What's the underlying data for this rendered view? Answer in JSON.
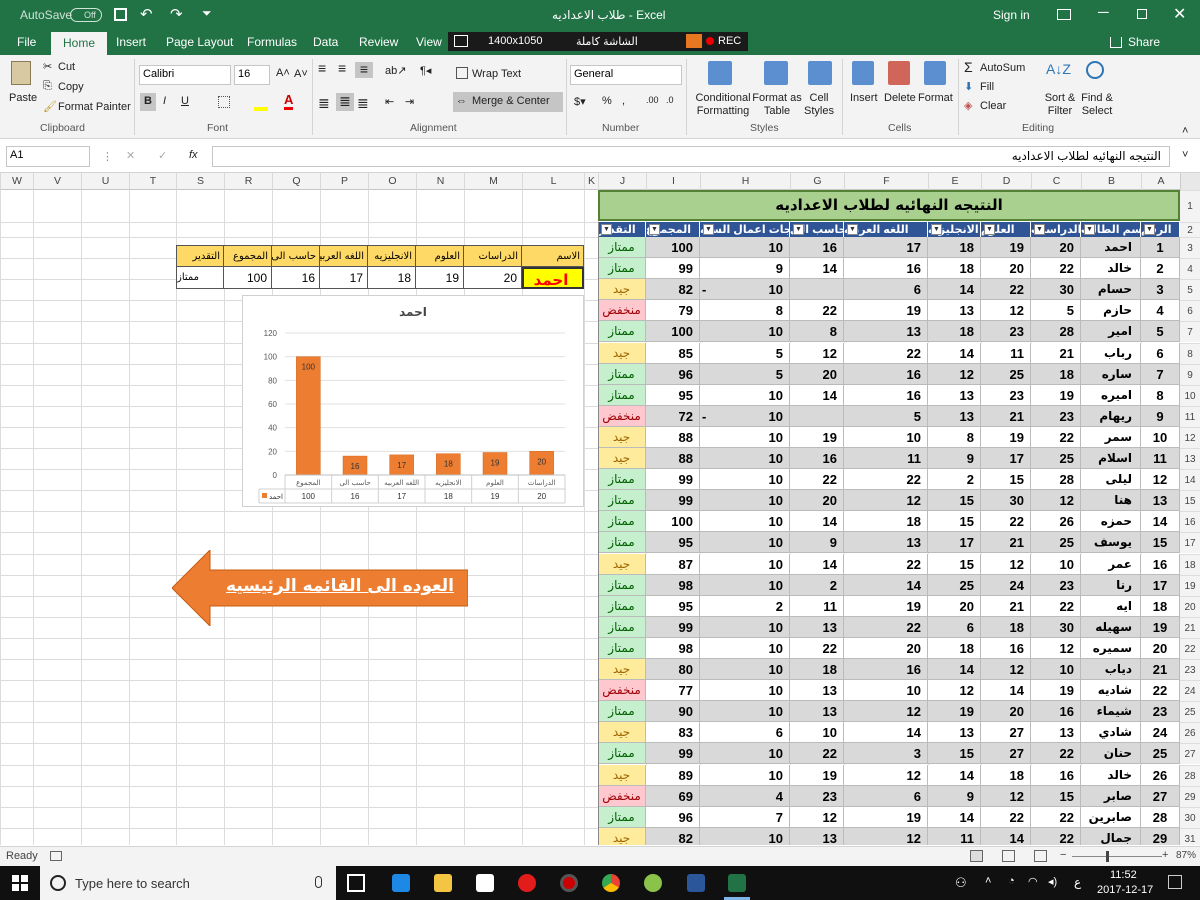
{
  "titlebar": {
    "autosave": "AutoSave",
    "autosave_state": "Off",
    "title": "طلاب الاعداديه  -  Excel",
    "signin": "Sign in"
  },
  "tabs": [
    "File",
    "Home",
    "Insert",
    "Page Layout",
    "Formulas",
    "Data",
    "Review",
    "View"
  ],
  "recorder": {
    "resolution": "1400x1050",
    "mode": "الشاشة كاملة",
    "rec": "REC"
  },
  "share": "Share",
  "ribbon": {
    "clipboard": {
      "paste": "Paste",
      "cut": "Cut",
      "copy": "Copy",
      "format_painter": "Format Painter",
      "group": "Clipboard"
    },
    "font": {
      "name": "Calibri",
      "size": "16",
      "bold": "B",
      "italic": "I",
      "underline": "U",
      "group": "Font"
    },
    "alignment": {
      "wrap": "Wrap Text",
      "merge": "Merge & Center",
      "group": "Alignment"
    },
    "number": {
      "format": "General",
      "group": "Number"
    },
    "styles": {
      "conditional": "Conditional Formatting",
      "format_table": "Format as Table",
      "cell_styles": "Cell Styles",
      "group": "Styles"
    },
    "cells": {
      "insert": "Insert",
      "delete": "Delete",
      "format": "Format",
      "group": "Cells"
    },
    "editing": {
      "autosum": "AutoSum",
      "fill": "Fill",
      "clear": "Clear",
      "sort": "Sort & Filter",
      "find": "Find & Select",
      "group": "Editing"
    }
  },
  "formula_bar": {
    "name_box": "A1",
    "fx": "fx",
    "content": "النتيجه النهائيه لطلاب الاعداديه"
  },
  "columns": [
    "W",
    "V",
    "U",
    "T",
    "S",
    "R",
    "Q",
    "P",
    "O",
    "N",
    "M",
    "L",
    "K",
    "J",
    "I",
    "H",
    "G",
    "F",
    "E",
    "D",
    "C",
    "B",
    "A"
  ],
  "row_numbers": [
    1,
    2,
    3,
    4,
    5,
    6,
    7,
    8,
    9,
    10,
    11,
    12,
    13,
    14,
    15,
    16,
    17,
    18,
    19,
    20,
    21,
    22,
    23,
    24,
    25,
    26,
    27,
    28,
    29,
    30,
    31
  ],
  "sheet_title": "النتيجه النهائيه لطلاب الاعداديه",
  "table_headers": [
    "الرقم",
    "اسم الطالب",
    "الدراسات",
    "العلوم",
    "الانجليزيه",
    "اللغه العربيه",
    "حاسب الى",
    "درجات اعمال السنه",
    "المجموع",
    "التقدير"
  ],
  "students": [
    [
      "1",
      "احمد",
      "20",
      "19",
      "18",
      "17",
      "16",
      "10",
      "100",
      "ممتاز"
    ],
    [
      "2",
      "خالد",
      "22",
      "20",
      "18",
      "16",
      "14",
      "9",
      "99",
      "ممتاز"
    ],
    [
      "3",
      "حسام",
      "30",
      "22",
      "14",
      "6",
      "",
      "10",
      "82",
      "جيد"
    ],
    [
      "4",
      "حازم",
      "5",
      "12",
      "13",
      "19",
      "22",
      "8",
      "79",
      "منخفض"
    ],
    [
      "5",
      "امير",
      "28",
      "23",
      "18",
      "13",
      "8",
      "10",
      "100",
      "ممتاز"
    ],
    [
      "6",
      "رباب",
      "21",
      "11",
      "14",
      "22",
      "12",
      "5",
      "85",
      "جيد"
    ],
    [
      "7",
      "ساره",
      "18",
      "25",
      "12",
      "16",
      "20",
      "5",
      "96",
      "ممتاز"
    ],
    [
      "8",
      "اميره",
      "19",
      "23",
      "13",
      "16",
      "14",
      "10",
      "95",
      "ممتاز"
    ],
    [
      "9",
      "ريهام",
      "23",
      "21",
      "13",
      "5",
      "",
      "10",
      "72",
      "منخفض"
    ],
    [
      "10",
      "سمر",
      "22",
      "19",
      "8",
      "10",
      "19",
      "10",
      "88",
      "جيد"
    ],
    [
      "11",
      "اسلام",
      "25",
      "17",
      "9",
      "11",
      "16",
      "10",
      "88",
      "جيد"
    ],
    [
      "12",
      "ليلى",
      "28",
      "15",
      "2",
      "22",
      "22",
      "10",
      "99",
      "ممتاز"
    ],
    [
      "13",
      "هنا",
      "12",
      "30",
      "15",
      "12",
      "20",
      "10",
      "99",
      "ممتاز"
    ],
    [
      "14",
      "حمزه",
      "26",
      "22",
      "15",
      "18",
      "14",
      "10",
      "100",
      "ممتاز"
    ],
    [
      "15",
      "يوسف",
      "25",
      "21",
      "17",
      "13",
      "9",
      "10",
      "95",
      "ممتاز"
    ],
    [
      "16",
      "عمر",
      "10",
      "12",
      "15",
      "22",
      "14",
      "10",
      "87",
      "جيد"
    ],
    [
      "17",
      "رنا",
      "23",
      "24",
      "25",
      "14",
      "2",
      "10",
      "98",
      "ممتاز"
    ],
    [
      "18",
      "ايه",
      "22",
      "21",
      "20",
      "19",
      "11",
      "2",
      "95",
      "ممتاز"
    ],
    [
      "19",
      "سهيله",
      "30",
      "18",
      "6",
      "22",
      "13",
      "10",
      "99",
      "ممتاز"
    ],
    [
      "20",
      "سميره",
      "12",
      "16",
      "18",
      "20",
      "22",
      "10",
      "98",
      "ممتاز"
    ],
    [
      "21",
      "دياب",
      "10",
      "12",
      "14",
      "16",
      "18",
      "10",
      "80",
      "جيد"
    ],
    [
      "22",
      "شاديه",
      "19",
      "14",
      "12",
      "10",
      "13",
      "10",
      "77",
      "منخفض"
    ],
    [
      "23",
      "شيماء",
      "16",
      "20",
      "19",
      "12",
      "13",
      "10",
      "90",
      "ممتاز"
    ],
    [
      "24",
      "شادي",
      "13",
      "27",
      "13",
      "14",
      "10",
      "6",
      "83",
      "جيد"
    ],
    [
      "25",
      "حنان",
      "22",
      "27",
      "15",
      "3",
      "22",
      "10",
      "99",
      "ممتاز"
    ],
    [
      "26",
      "خالد",
      "16",
      "18",
      "14",
      "12",
      "19",
      "10",
      "89",
      "جيد"
    ],
    [
      "27",
      "صابر",
      "15",
      "12",
      "9",
      "6",
      "23",
      "4",
      "69",
      "منخفض"
    ],
    [
      "28",
      "صابرين",
      "22",
      "22",
      "14",
      "19",
      "12",
      "7",
      "96",
      "ممتاز"
    ],
    [
      "29",
      "جمال",
      "22",
      "14",
      "11",
      "12",
      "13",
      "10",
      "82",
      "جيد"
    ]
  ],
  "lookup": {
    "headers": [
      "الاسم",
      "الدراسات",
      "العلوم",
      "الانجليزيه",
      "اللغه العربيه",
      "حاسب الى",
      "المجموع",
      "التقدير"
    ],
    "values": [
      "احمد",
      "20",
      "19",
      "18",
      "17",
      "16",
      "100",
      "ممتاز"
    ]
  },
  "chart_data": {
    "type": "bar",
    "title": "احمد",
    "categories": [
      "الدراسات",
      "العلوم",
      "الانجليزيه",
      "اللغه العربيه",
      "حاسب الى",
      "المجموع"
    ],
    "series": [
      {
        "name": "احمد",
        "values": [
          20,
          19,
          18,
          17,
          16,
          100
        ]
      }
    ],
    "ylim": [
      0,
      120
    ],
    "yticks": [
      0,
      20,
      40,
      60,
      80,
      100,
      120
    ],
    "data_labels": true,
    "data_table": true,
    "bar_color": "#ed7d31"
  },
  "back_button": "العوده الى القائمه الرئيسيه",
  "status": {
    "ready": "Ready",
    "zoom": "87%"
  },
  "taskbar": {
    "search": "Type here to search",
    "lang": "ع",
    "time": "11:52",
    "date": "2017-12-17"
  },
  "colors": {
    "excel_green": "#217346",
    "header_blue": "#2f5597",
    "title_green": "#a9d08e",
    "lookup_yellow": "#ffd966",
    "good_green": "#c6efce",
    "warn_yellow": "#ffeb9c",
    "bad_red": "#ffc7ce",
    "arrow_orange": "#ed7d31"
  }
}
